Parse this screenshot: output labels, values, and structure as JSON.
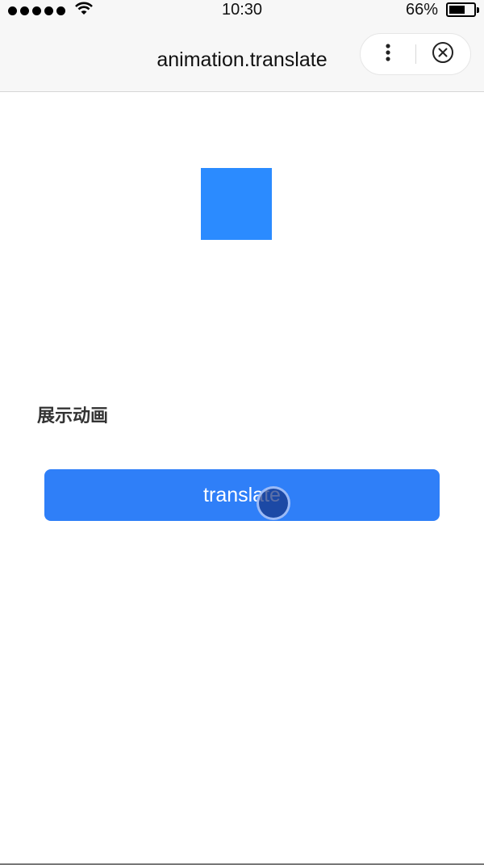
{
  "status_bar": {
    "time": "10:30",
    "battery_percent": "66%",
    "battery_level": 0.66,
    "signal_icon": "signal-dots-icon",
    "wifi_icon": "wifi-icon"
  },
  "nav": {
    "title": "animation.translate",
    "more_icon": "more-vertical-icon",
    "close_icon": "close-circle-icon"
  },
  "main": {
    "section_label": "展示动画",
    "button_label": "translate",
    "box_color": "#2b8bff",
    "button_color": "#2f7ff8"
  }
}
